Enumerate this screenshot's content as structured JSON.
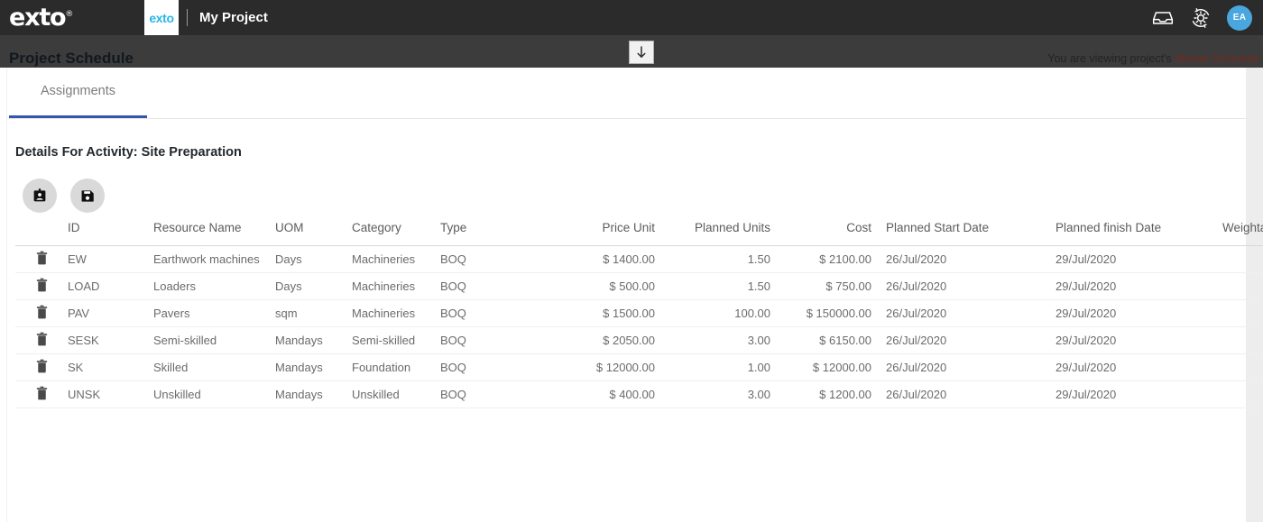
{
  "topbar": {
    "logo": "exto",
    "project_badge": "exto",
    "project_name": "My Project",
    "icons": {
      "inbox": "inbox-tray-icon",
      "settings_sync": "gear-refresh-icon"
    },
    "avatar_initials": "EA"
  },
  "subbar": {
    "page_title": "Project Schedule",
    "viewing_prefix": "You are viewing project's ",
    "viewing_target": "Master Schedule",
    "collapse_icon": "down-arrow-icon"
  },
  "tabs": [
    {
      "label": "Assignments",
      "active": true
    }
  ],
  "section": {
    "title": "Details For Activity: Site Preparation",
    "buttons": [
      {
        "name": "assign-resource-button",
        "icon": "id-badge-icon"
      },
      {
        "name": "save-button",
        "icon": "floppy-save-icon"
      }
    ]
  },
  "table": {
    "columns": [
      "",
      "ID",
      "Resource Name",
      "UOM",
      "Category",
      "Type",
      "Price Unit",
      "Planned Units",
      "Cost",
      "Planned Start Date",
      "Planned finish Date",
      "Weighta"
    ],
    "rows": [
      {
        "delete_icon": "trash-icon",
        "id": "EW",
        "resource_name": "Earthwork machines",
        "uom": "Days",
        "category": "Machineries",
        "type": "BOQ",
        "price_unit": "$ 1400.00",
        "planned_units": "1.50",
        "cost": "$ 2100.00",
        "planned_start_date": "26/Jul/2020",
        "planned_finish_date": "29/Jul/2020",
        "weightage": ""
      },
      {
        "delete_icon": "trash-icon",
        "id": "LOAD",
        "resource_name": "Loaders",
        "uom": "Days",
        "category": "Machineries",
        "type": "BOQ",
        "price_unit": "$ 500.00",
        "planned_units": "1.50",
        "cost": "$ 750.00",
        "planned_start_date": "26/Jul/2020",
        "planned_finish_date": "29/Jul/2020",
        "weightage": ""
      },
      {
        "delete_icon": "trash-icon",
        "id": "PAV",
        "resource_name": "Pavers",
        "uom": "sqm",
        "category": "Machineries",
        "type": "BOQ",
        "price_unit": "$ 1500.00",
        "planned_units": "100.00",
        "cost": "$ 150000.00",
        "planned_start_date": "26/Jul/2020",
        "planned_finish_date": "29/Jul/2020",
        "weightage": ""
      },
      {
        "delete_icon": "trash-icon",
        "id": "SESK",
        "resource_name": "Semi-skilled",
        "uom": "Mandays",
        "category": "Semi-skilled",
        "type": "BOQ",
        "price_unit": "$ 2050.00",
        "planned_units": "3.00",
        "cost": "$ 6150.00",
        "planned_start_date": "26/Jul/2020",
        "planned_finish_date": "29/Jul/2020",
        "weightage": ""
      },
      {
        "delete_icon": "trash-icon",
        "id": "SK",
        "resource_name": "Skilled",
        "uom": "Mandays",
        "category": "Foundation",
        "type": "BOQ",
        "price_unit": "$ 12000.00",
        "planned_units": "1.00",
        "cost": "$ 12000.00",
        "planned_start_date": "26/Jul/2020",
        "planned_finish_date": "29/Jul/2020",
        "weightage": ""
      },
      {
        "delete_icon": "trash-icon",
        "id": "UNSK",
        "resource_name": "Unskilled",
        "uom": "Mandays",
        "category": "Unskilled",
        "type": "BOQ",
        "price_unit": "$ 400.00",
        "planned_units": "3.00",
        "cost": "$ 1200.00",
        "planned_start_date": "26/Jul/2020",
        "planned_finish_date": "29/Jul/2020",
        "weightage": ""
      }
    ]
  },
  "colors": {
    "topbar_bg": "#2b2b2b",
    "subbar_bg": "#3c3c3c",
    "accent_blue": "#3355ab",
    "badge_cyan": "#29b6e8",
    "avatar_blue": "#4aa7dd",
    "master_schedule_red": "#6e2a22"
  }
}
